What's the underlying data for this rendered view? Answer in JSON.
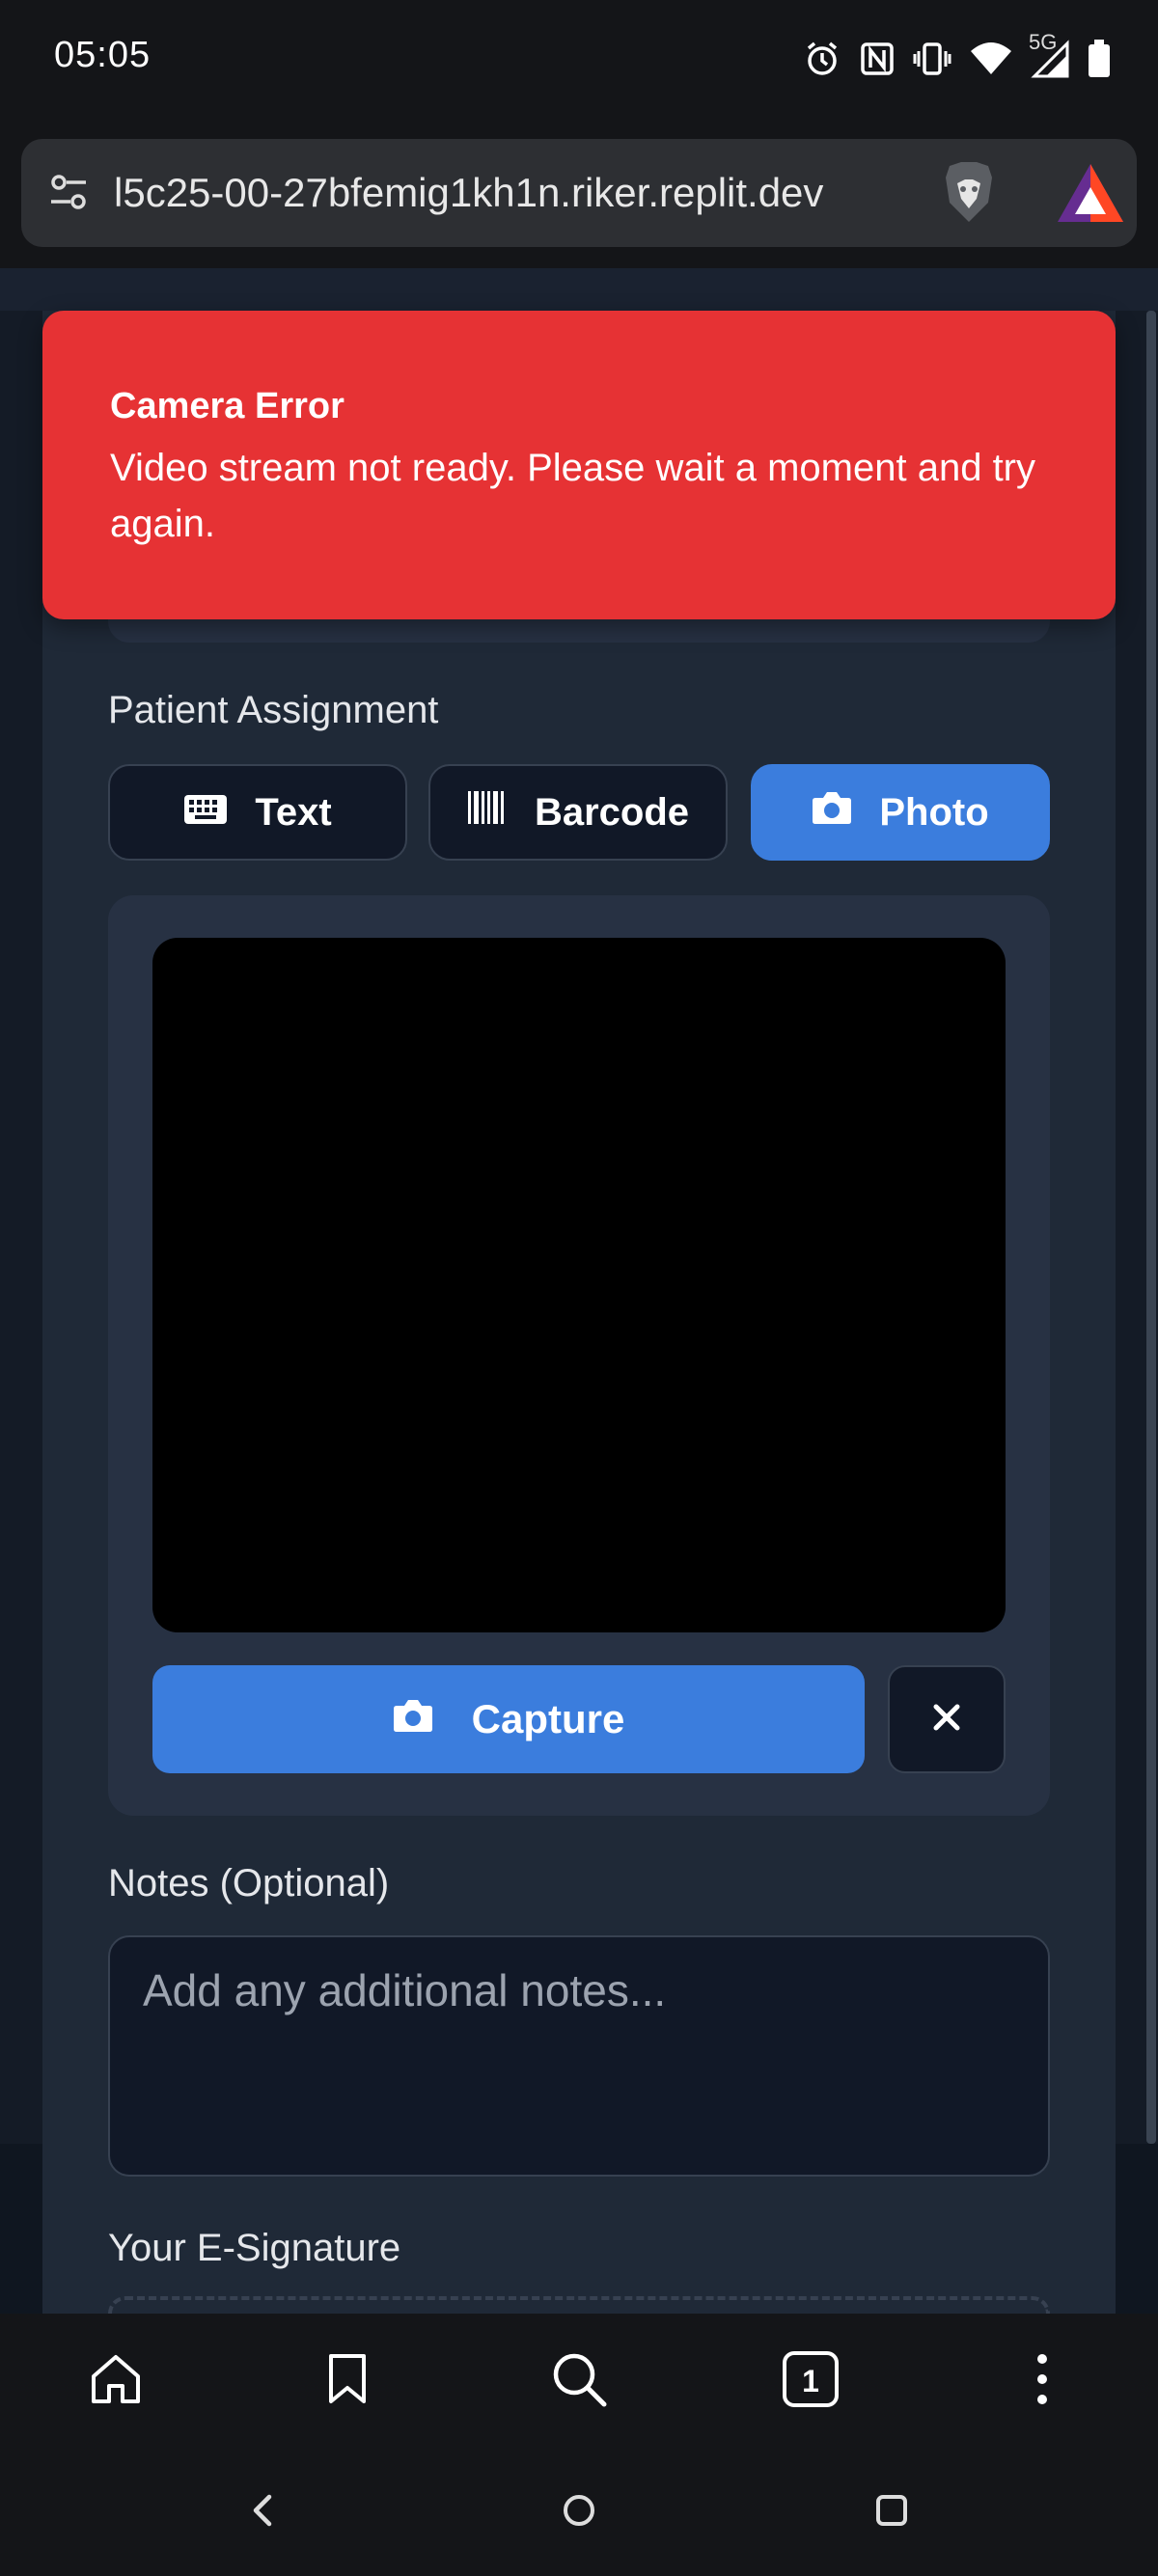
{
  "status_bar": {
    "time": "05:05",
    "network_label": "5G",
    "icons": [
      "alarm-icon",
      "nfc-icon",
      "vibrate-icon",
      "wifi-icon",
      "signal-icon",
      "battery-icon"
    ]
  },
  "browser": {
    "url": "l5c25-00-27bfemig1kh1n.riker.replit.dev",
    "icons": [
      "site-settings-icon",
      "brave-shields-icon",
      "brave-rewards-icon"
    ]
  },
  "toast": {
    "title": "Camera Error",
    "message": "Video stream not ready. Please wait a moment and try again.",
    "color": "#e63234"
  },
  "form": {
    "patient_assignment_label": "Patient Assignment",
    "tabs": [
      {
        "label": "Text",
        "icon": "keyboard-icon",
        "active": false
      },
      {
        "label": "Barcode",
        "icon": "barcode-icon",
        "active": false
      },
      {
        "label": "Photo",
        "icon": "camera-icon",
        "active": true
      }
    ],
    "capture_label": "Capture",
    "notes_label": "Notes (Optional)",
    "notes_placeholder": "Add any additional notes...",
    "signature_label": "Your E-Signature"
  },
  "toolbar": {
    "tab_count": "1",
    "buttons": [
      "home-icon",
      "bookmark-icon",
      "search-icon",
      "tabs-icon",
      "menu-icon"
    ]
  },
  "colors": {
    "accent": "#3b7ddd",
    "panel": "#1f2937",
    "error": "#e63234"
  }
}
